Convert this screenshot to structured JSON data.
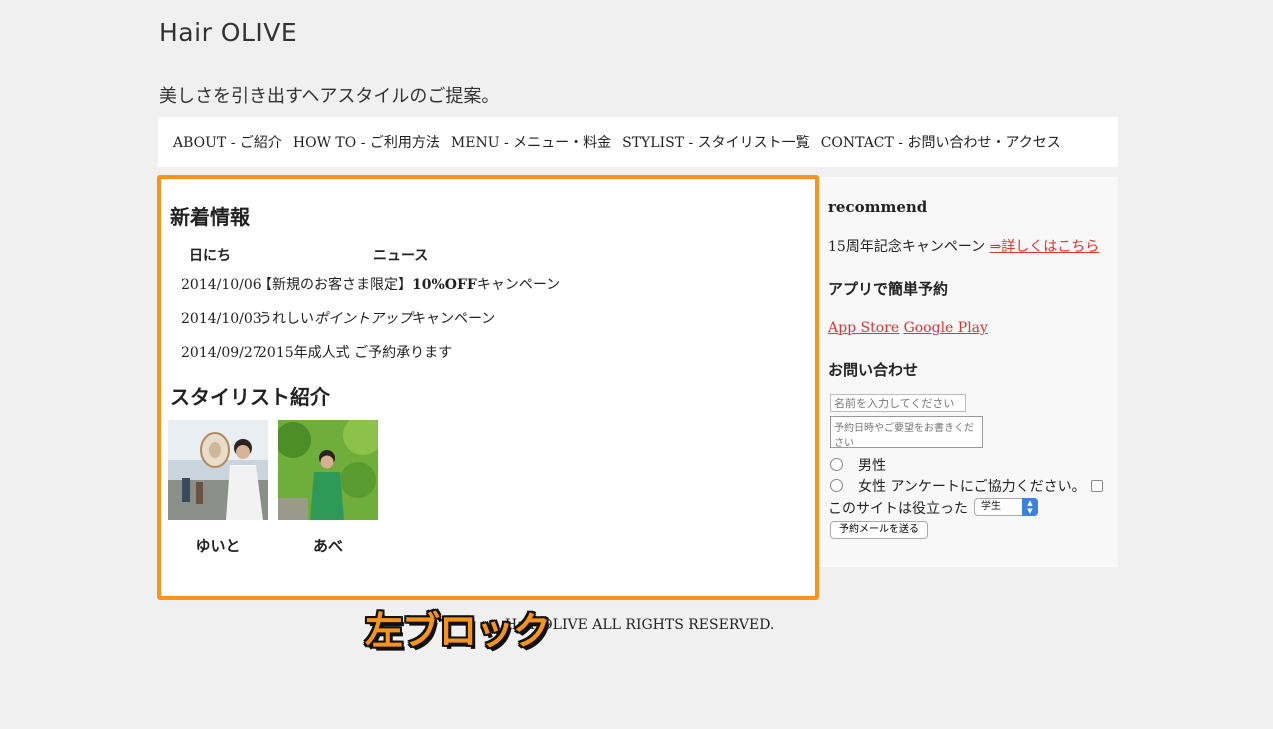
{
  "header": {
    "logo": "Hair OLIVE",
    "tagline": "美しさを引き出すヘアスタイルのご提案。"
  },
  "nav": {
    "items": [
      {
        "label": "ABOUT - ご紹介"
      },
      {
        "label": "HOW TO - ご利用方法"
      },
      {
        "label": "MENU - メニュー・料金"
      },
      {
        "label": "STYLIST - スタイリスト一覧"
      },
      {
        "label": "CONTACT - お問い合わせ・アクセス"
      }
    ]
  },
  "main": {
    "news_title": "新着情報",
    "news_columns": [
      "日にち",
      "ニュース"
    ],
    "news": [
      {
        "date": "2014/10/06",
        "pre": "【新規のお客さま限定】",
        "bold": "10%OFF",
        "post": "キャンペーン"
      },
      {
        "date": "2014/10/03",
        "pre": "うれしい",
        "italic": "ポイントアップ",
        "post": "キャンペーン"
      },
      {
        "date": "2014/09/27",
        "pre": "2015年成人式 ご予約承ります"
      }
    ],
    "stylist_title": "スタイリスト紹介",
    "stylists": [
      {
        "name": "ゆいと"
      },
      {
        "name": "あべ"
      }
    ]
  },
  "sidebar": {
    "recommend_heading": "recommend",
    "campaign_text": "15周年記念キャンペーン",
    "campaign_link": "⇒詳しくはこちら",
    "app_heading": "アプリで簡単予約",
    "app_store": "App Store",
    "google_play": "Google Play",
    "contact_heading": "お問い合わせ",
    "name_placeholder": "名前を入力してください",
    "message_placeholder": "予約日時やご要望をお書きください",
    "radio_male": "男性",
    "radio_female": "女性",
    "survey_label": "アンケートにご協力ください。",
    "useful_label": "このサイトは役立った",
    "select_value": "学生",
    "submit_label": "予約メールを送る"
  },
  "footer": {
    "copyright": "Hair OLIVE ALL RIGHTS RESERVED."
  },
  "annotation": {
    "label": "左ブロック",
    "color": "#f7941d"
  }
}
